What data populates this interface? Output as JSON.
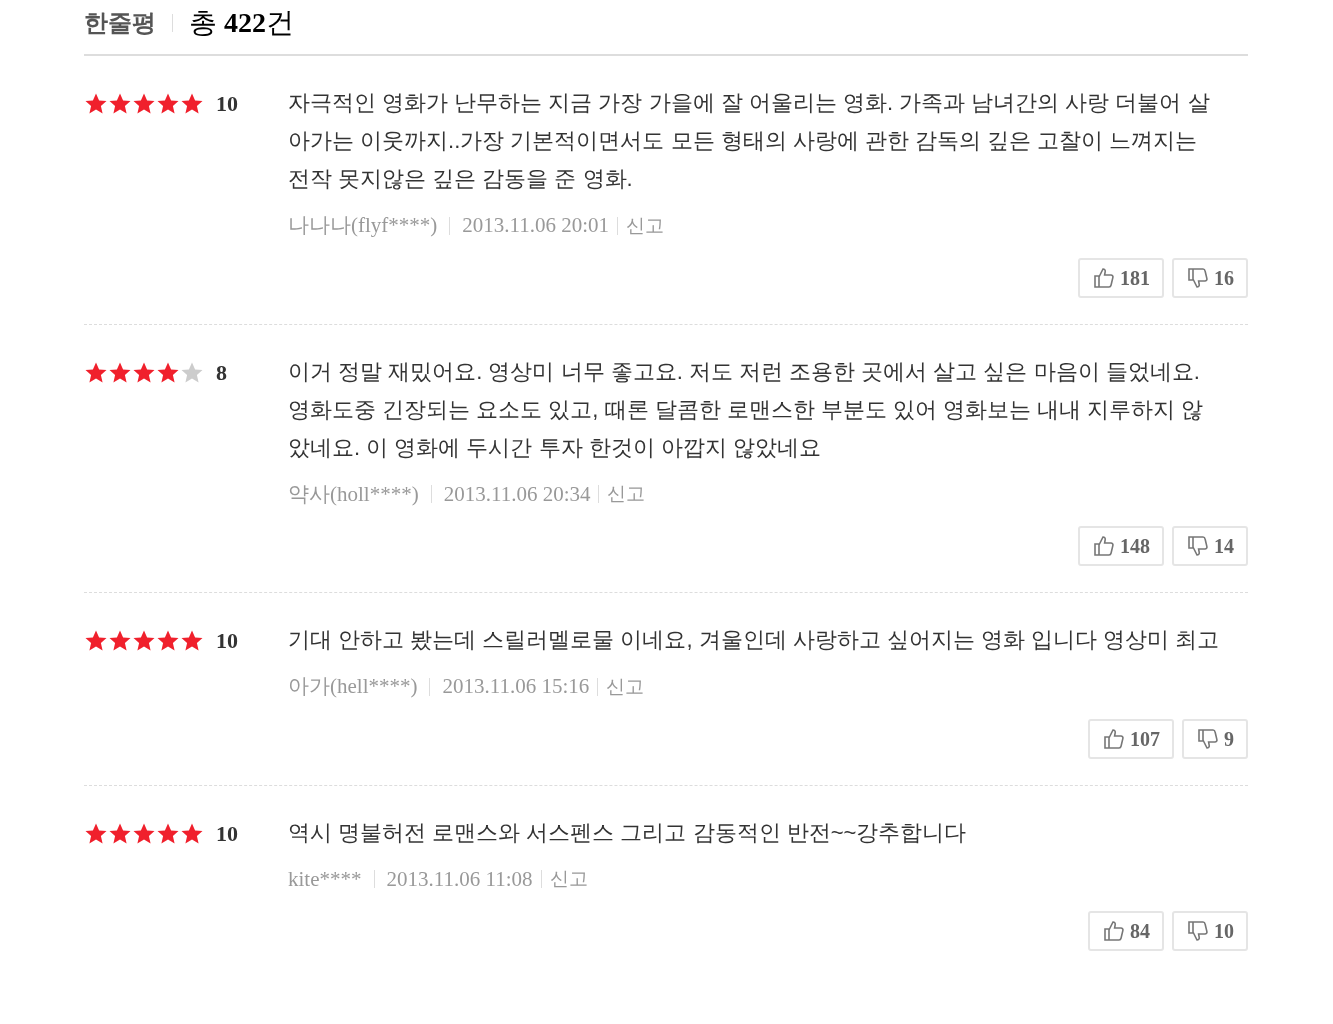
{
  "header": {
    "title": "한줄평",
    "total": "총 **422**건"
  },
  "reviews": [
    {
      "stars": 5,
      "score": "10",
      "text": "자극적인 영화가 난무하는 지금 가장 가을에 잘 어울리는 영화. 가족과 남녀간의 사랑 더불어 살아가는 이웃까지..가장 기본적이면서도 모든 형태의 사랑에 관한 감독의 깊은 고찰이 느껴지는 전작 못지않은 깊은 감동을 준 영화.",
      "author": "나나나(flyf****)",
      "date": "2013.11.06 20:01",
      "report": "신고",
      "likes": "181",
      "dislikes": "16"
    },
    {
      "stars": 4,
      "score": "8",
      "text": "이거 정말 재밌어요. 영상미 너무 좋고요. 저도 저런 조용한 곳에서 살고 싶은 마음이 들었네요. 영화도중 긴장되는 요소도 있고, 때론 달콤한 로맨스한 부분도 있어 영화보는 내내 지루하지 않았네요. 이 영화에 두시간 투자 한것이 아깝지 않았네요",
      "author": "약사(holl****)",
      "date": "2013.11.06 20:34",
      "report": "신고",
      "likes": "148",
      "dislikes": "14"
    },
    {
      "stars": 5,
      "score": "10",
      "text": "기대 안하고 봤는데 스릴러멜로물 이네요, 겨울인데 사랑하고 싶어지는 영화 입니다 영상미 최고",
      "author": "아가(hell****)",
      "date": "2013.11.06 15:16",
      "report": "신고",
      "likes": "107",
      "dislikes": "9"
    },
    {
      "stars": 5,
      "score": "10",
      "text": "역시 명불허전 로맨스와 서스펜스 그리고 감동적인 반전~~강추합니다",
      "author": "kite****",
      "date": "2013.11.06 11:08",
      "report": "신고",
      "likes": "84",
      "dislikes": "10"
    }
  ]
}
